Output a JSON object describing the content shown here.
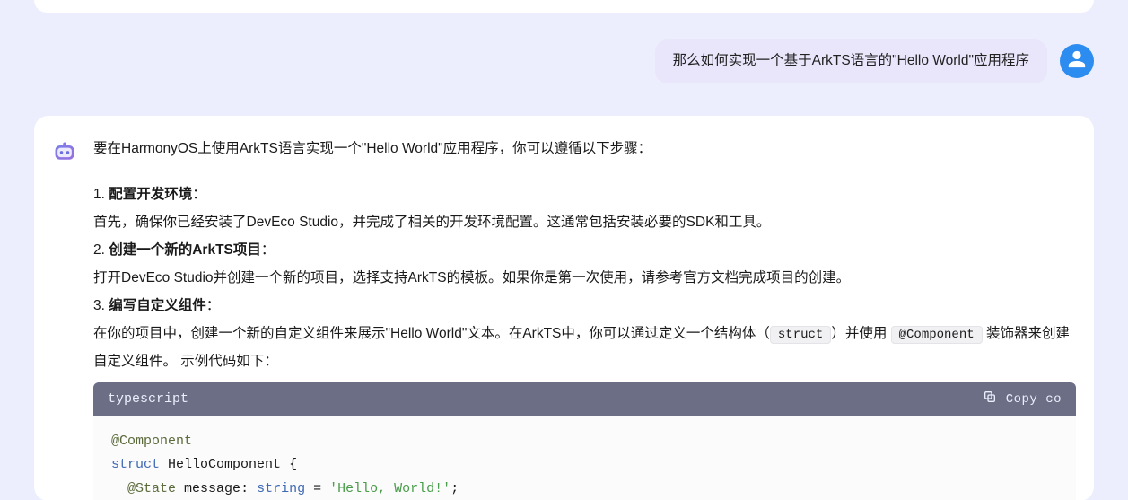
{
  "user_message": {
    "text": "那么如何实现一个基于ArkTS语言的\"Hello World\"应用程序"
  },
  "assistant": {
    "intro": "要在HarmonyOS上使用ArkTS语言实现一个\"Hello World\"应用程序，你可以遵循以下步骤：",
    "steps": [
      {
        "num": "1.",
        "title": "配置开发环境",
        "colon": "：",
        "body_parts": [
          "首先，确保你已经安装了DevEco Studio，并完成了相关的开发环境配置。这通常包括安装必要的SDK和工具。"
        ]
      },
      {
        "num": "2.",
        "title": "创建一个新的ArkTS项目",
        "colon": "：",
        "body_parts": [
          "打开DevEco Studio并创建一个新的项目，选择支持ArkTS的模板。如果你是第一次使用，请参考官方文档完成项目的创建。"
        ]
      },
      {
        "num": "3.",
        "title": "编写自定义组件",
        "colon": "：",
        "body_parts": [
          "在你的项目中，创建一个新的自定义组件来展示\"Hello World\"文本。在ArkTS中，你可以通过定义一个结构体（",
          {
            "code": "struct"
          },
          "）并使用 ",
          {
            "code": "@Component"
          },
          " 装饰器来创建自定义组件。 示例代码如下："
        ]
      }
    ],
    "code": {
      "language": "typescript",
      "copy_label": "Copy co",
      "lines": [
        [
          {
            "t": "dec",
            "v": "@Component"
          }
        ],
        [
          {
            "t": "kw",
            "v": "struct"
          },
          {
            "t": "sp",
            "v": " "
          },
          {
            "t": "id",
            "v": "HelloComponent"
          },
          {
            "t": "sp",
            "v": " "
          },
          {
            "t": "punc",
            "v": "{"
          }
        ],
        [
          {
            "t": "sp",
            "v": "  "
          },
          {
            "t": "dec",
            "v": "@State"
          },
          {
            "t": "sp",
            "v": " "
          },
          {
            "t": "id",
            "v": "message"
          },
          {
            "t": "punc",
            "v": ":"
          },
          {
            "t": "sp",
            "v": " "
          },
          {
            "t": "type",
            "v": "string"
          },
          {
            "t": "sp",
            "v": " "
          },
          {
            "t": "punc",
            "v": "="
          },
          {
            "t": "sp",
            "v": " "
          },
          {
            "t": "str",
            "v": "'Hello, World!'"
          },
          {
            "t": "punc",
            "v": ";"
          }
        ]
      ]
    }
  }
}
